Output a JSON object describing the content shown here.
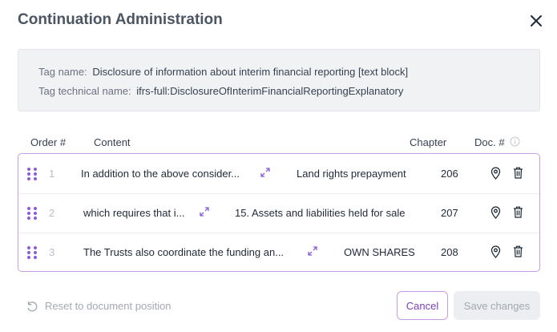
{
  "dialog": {
    "title": "Continuation Administration"
  },
  "tag": {
    "name_label": "Tag name:",
    "name_value": "Disclosure of information about interim financial reporting [text block]",
    "technical_label": "Tag technical name:",
    "technical_value": "ifrs-full:DisclosureOfInterimFinancialReportingExplanatory"
  },
  "table": {
    "headers": {
      "order": "Order #",
      "content": "Content",
      "chapter": "Chapter",
      "doc": "Doc. #"
    },
    "rows": [
      {
        "order": "1",
        "content": "In addition to the above consider...",
        "chapter": "Land rights prepayment",
        "doc": "206"
      },
      {
        "order": "2",
        "content": "which requires that i...",
        "chapter": "15. Assets and liabilities held for sale",
        "doc": "207"
      },
      {
        "order": "3",
        "content": "The Trusts also coordinate the funding an...",
        "chapter": "OWN SHARES",
        "doc": "208"
      }
    ]
  },
  "footer": {
    "reset_label": "Reset to document position",
    "cancel_label": "Cancel",
    "save_label": "Save changes"
  },
  "colors": {
    "accent": "#8b5cd6",
    "border_accent": "#c99ce3",
    "disabled": "#a3a8b1"
  },
  "icons": {
    "close": "close-icon",
    "info": "info-icon",
    "drag": "drag-handle-icon",
    "expand": "expand-icon",
    "pin": "location-pin-icon",
    "trash": "trash-icon",
    "reset": "reset-icon"
  }
}
